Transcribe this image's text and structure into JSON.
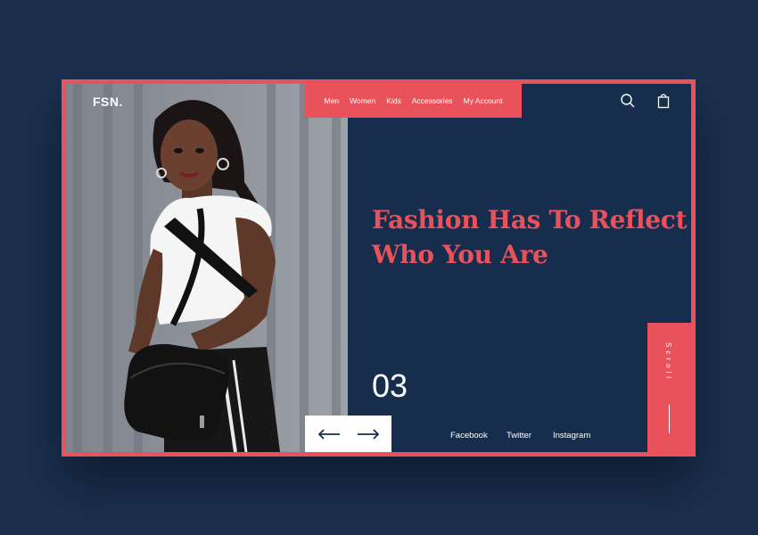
{
  "brand": {
    "logo": "FSN."
  },
  "nav": {
    "items": [
      {
        "label": "Men"
      },
      {
        "label": "Women"
      },
      {
        "label": "Kids"
      },
      {
        "label": "Accessories"
      },
      {
        "label": "My Account"
      }
    ]
  },
  "header_icons": [
    "search-icon",
    "shopping-bag-icon"
  ],
  "hero": {
    "headline_line1": "Fashion Has To Reflect",
    "headline_line2": "Who You Are",
    "slide_number": "03"
  },
  "slider_controls": [
    "arrow-left-icon",
    "arrow-right-icon"
  ],
  "social": {
    "facebook": "Facebook",
    "twitter": "Twitter",
    "instagram": "Instagram"
  },
  "scroll": {
    "label": "Scroll"
  },
  "colors": {
    "background": "#1b2f4d",
    "panel": "#162d4d",
    "accent": "#e9525a",
    "text_light": "#ffffff"
  }
}
